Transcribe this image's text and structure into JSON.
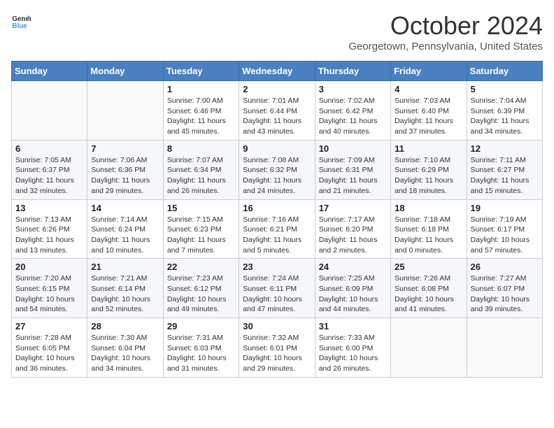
{
  "header": {
    "logo_general": "General",
    "logo_blue": "Blue",
    "month": "October 2024",
    "location": "Georgetown, Pennsylvania, United States"
  },
  "days_of_week": [
    "Sunday",
    "Monday",
    "Tuesday",
    "Wednesday",
    "Thursday",
    "Friday",
    "Saturday"
  ],
  "weeks": [
    [
      {
        "day": "",
        "info": ""
      },
      {
        "day": "",
        "info": ""
      },
      {
        "day": "1",
        "info": "Sunrise: 7:00 AM\nSunset: 6:46 PM\nDaylight: 11 hours and 45 minutes."
      },
      {
        "day": "2",
        "info": "Sunrise: 7:01 AM\nSunset: 6:44 PM\nDaylight: 11 hours and 43 minutes."
      },
      {
        "day": "3",
        "info": "Sunrise: 7:02 AM\nSunset: 6:42 PM\nDaylight: 11 hours and 40 minutes."
      },
      {
        "day": "4",
        "info": "Sunrise: 7:03 AM\nSunset: 6:40 PM\nDaylight: 11 hours and 37 minutes."
      },
      {
        "day": "5",
        "info": "Sunrise: 7:04 AM\nSunset: 6:39 PM\nDaylight: 11 hours and 34 minutes."
      }
    ],
    [
      {
        "day": "6",
        "info": "Sunrise: 7:05 AM\nSunset: 6:37 PM\nDaylight: 11 hours and 32 minutes."
      },
      {
        "day": "7",
        "info": "Sunrise: 7:06 AM\nSunset: 6:36 PM\nDaylight: 11 hours and 29 minutes."
      },
      {
        "day": "8",
        "info": "Sunrise: 7:07 AM\nSunset: 6:34 PM\nDaylight: 11 hours and 26 minutes."
      },
      {
        "day": "9",
        "info": "Sunrise: 7:08 AM\nSunset: 6:32 PM\nDaylight: 11 hours and 24 minutes."
      },
      {
        "day": "10",
        "info": "Sunrise: 7:09 AM\nSunset: 6:31 PM\nDaylight: 11 hours and 21 minutes."
      },
      {
        "day": "11",
        "info": "Sunrise: 7:10 AM\nSunset: 6:29 PM\nDaylight: 11 hours and 18 minutes."
      },
      {
        "day": "12",
        "info": "Sunrise: 7:11 AM\nSunset: 6:27 PM\nDaylight: 11 hours and 15 minutes."
      }
    ],
    [
      {
        "day": "13",
        "info": "Sunrise: 7:13 AM\nSunset: 6:26 PM\nDaylight: 11 hours and 13 minutes."
      },
      {
        "day": "14",
        "info": "Sunrise: 7:14 AM\nSunset: 6:24 PM\nDaylight: 11 hours and 10 minutes."
      },
      {
        "day": "15",
        "info": "Sunrise: 7:15 AM\nSunset: 6:23 PM\nDaylight: 11 hours and 7 minutes."
      },
      {
        "day": "16",
        "info": "Sunrise: 7:16 AM\nSunset: 6:21 PM\nDaylight: 11 hours and 5 minutes."
      },
      {
        "day": "17",
        "info": "Sunrise: 7:17 AM\nSunset: 6:20 PM\nDaylight: 11 hours and 2 minutes."
      },
      {
        "day": "18",
        "info": "Sunrise: 7:18 AM\nSunset: 6:18 PM\nDaylight: 11 hours and 0 minutes."
      },
      {
        "day": "19",
        "info": "Sunrise: 7:19 AM\nSunset: 6:17 PM\nDaylight: 10 hours and 57 minutes."
      }
    ],
    [
      {
        "day": "20",
        "info": "Sunrise: 7:20 AM\nSunset: 6:15 PM\nDaylight: 10 hours and 54 minutes."
      },
      {
        "day": "21",
        "info": "Sunrise: 7:21 AM\nSunset: 6:14 PM\nDaylight: 10 hours and 52 minutes."
      },
      {
        "day": "22",
        "info": "Sunrise: 7:23 AM\nSunset: 6:12 PM\nDaylight: 10 hours and 49 minutes."
      },
      {
        "day": "23",
        "info": "Sunrise: 7:24 AM\nSunset: 6:11 PM\nDaylight: 10 hours and 47 minutes."
      },
      {
        "day": "24",
        "info": "Sunrise: 7:25 AM\nSunset: 6:09 PM\nDaylight: 10 hours and 44 minutes."
      },
      {
        "day": "25",
        "info": "Sunrise: 7:26 AM\nSunset: 6:08 PM\nDaylight: 10 hours and 41 minutes."
      },
      {
        "day": "26",
        "info": "Sunrise: 7:27 AM\nSunset: 6:07 PM\nDaylight: 10 hours and 39 minutes."
      }
    ],
    [
      {
        "day": "27",
        "info": "Sunrise: 7:28 AM\nSunset: 6:05 PM\nDaylight: 10 hours and 36 minutes."
      },
      {
        "day": "28",
        "info": "Sunrise: 7:30 AM\nSunset: 6:04 PM\nDaylight: 10 hours and 34 minutes."
      },
      {
        "day": "29",
        "info": "Sunrise: 7:31 AM\nSunset: 6:03 PM\nDaylight: 10 hours and 31 minutes."
      },
      {
        "day": "30",
        "info": "Sunrise: 7:32 AM\nSunset: 6:01 PM\nDaylight: 10 hours and 29 minutes."
      },
      {
        "day": "31",
        "info": "Sunrise: 7:33 AM\nSunset: 6:00 PM\nDaylight: 10 hours and 26 minutes."
      },
      {
        "day": "",
        "info": ""
      },
      {
        "day": "",
        "info": ""
      }
    ]
  ]
}
